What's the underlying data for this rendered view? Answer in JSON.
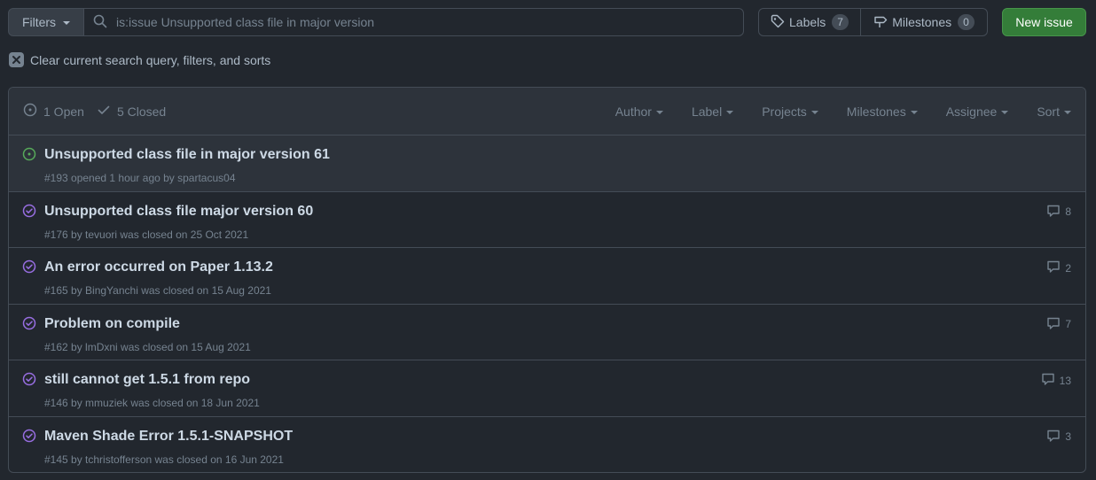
{
  "topbar": {
    "filters_label": "Filters",
    "search_value": "is:issue Unsupported class file in major version",
    "labels_label": "Labels",
    "labels_count": "7",
    "milestones_label": "Milestones",
    "milestones_count": "0",
    "new_issue_label": "New issue"
  },
  "clear_filters_label": "Clear current search query, filters, and sorts",
  "list_header": {
    "open_label": "1 Open",
    "closed_label": "5 Closed",
    "filters": [
      "Author",
      "Label",
      "Projects",
      "Milestones",
      "Assignee",
      "Sort"
    ]
  },
  "issues": [
    {
      "title": "Unsupported class file in major version 61",
      "meta": "#193 opened 1 hour ago by spartacus04",
      "state": "open",
      "comments": ""
    },
    {
      "title": "Unsupported class file major version 60",
      "meta": "#176 by tevuori was closed on 25 Oct 2021",
      "state": "closed",
      "comments": "8"
    },
    {
      "title": "An error occurred on Paper 1.13.2",
      "meta": "#165 by BingYanchi was closed on 15 Aug 2021",
      "state": "closed",
      "comments": "2"
    },
    {
      "title": "Problem on compile",
      "meta": "#162 by lmDxni was closed on 15 Aug 2021",
      "state": "closed",
      "comments": "7"
    },
    {
      "title": "still cannot get 1.5.1 from repo",
      "meta": "#146 by mmuziek was closed on 18 Jun 2021",
      "state": "closed",
      "comments": "13"
    },
    {
      "title": "Maven Shade Error 1.5.1-SNAPSHOT",
      "meta": "#145 by tchristofferson was closed on 16 Jun 2021",
      "state": "closed",
      "comments": "3"
    }
  ],
  "colors": {
    "background": "#22272e",
    "open_icon": "#57ab5a",
    "closed_icon": "#986ee2",
    "new_issue_button": "#347d39"
  },
  "icons": {
    "search": "search-icon",
    "labels": "tag-icon",
    "milestones": "milestone-icon",
    "clear": "x-icon",
    "open_state": "issue-opened-icon",
    "closed_state": "check-icon",
    "issue_open": "issue-opened-icon",
    "issue_closed": "issue-closed-icon",
    "comments": "comment-icon"
  }
}
